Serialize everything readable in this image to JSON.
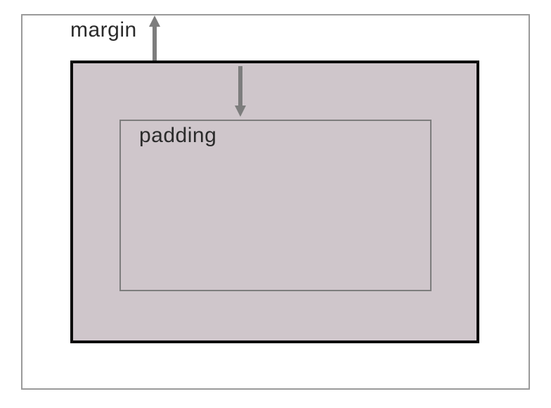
{
  "labels": {
    "margin": "margin",
    "padding": "padding"
  },
  "colors": {
    "outerBorder": "#9a9a9a",
    "boxBorder": "#0b0b0b",
    "fill": "#cfc6cb",
    "arrow": "#7d7d7d",
    "text": "#2b2b2b"
  }
}
